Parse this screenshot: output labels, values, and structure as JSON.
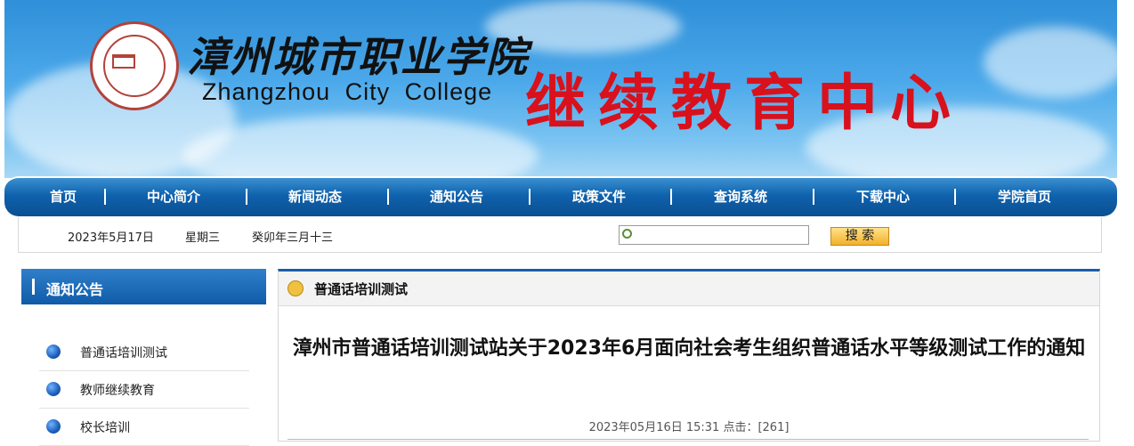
{
  "header": {
    "school_name_cn": "漳州城市职业学院",
    "school_name_en": "Zhangzhou City College",
    "center_title": "继续教育中心"
  },
  "nav": {
    "items": [
      "首页",
      "中心简介",
      "新闻动态",
      "通知公告",
      "政策文件",
      "查询系统",
      "下载中心",
      "学院首页"
    ]
  },
  "infobar": {
    "date": "2023年5月17日",
    "weekday": "星期三",
    "lunar": "癸卯年三月十三",
    "search_placeholder": "",
    "search_button": "搜 索"
  },
  "sidebar": {
    "title": "通知公告",
    "items": [
      "普通话培训测试",
      "教师继续教育",
      "校长培训"
    ]
  },
  "content": {
    "breadcrumb": "普通话培训测试",
    "title": "漳州市普通话培训测试站关于2023年6月面向社会考生组织普通话水平等级测试工作的通知",
    "meta": "2023年05月16日 15:31  点击：[261]"
  },
  "colors": {
    "brand_red": "#d8111d",
    "nav_blue": "#0f62ad"
  }
}
